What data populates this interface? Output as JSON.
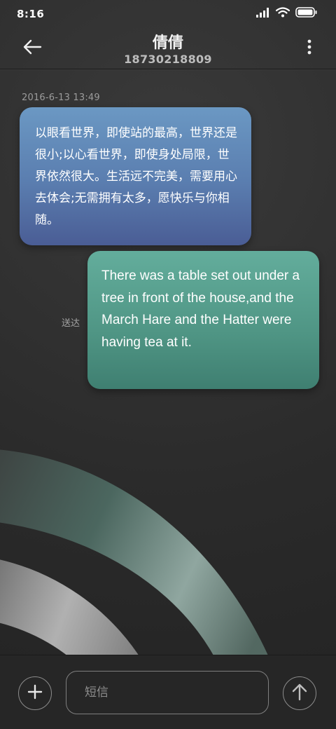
{
  "status_bar": {
    "time": "8:16",
    "icons": [
      "signal-icon",
      "wifi-icon",
      "battery-icon"
    ]
  },
  "header": {
    "contact_name": "倩倩",
    "contact_number": "18730218809",
    "back_icon": "back-arrow-icon",
    "menu_icon": "more-vertical-icon"
  },
  "conversation": {
    "timestamp": "2016-6-13 13:49",
    "messages": [
      {
        "direction": "incoming",
        "text": "以眼看世界，即使站的最高，世界还是很小;以心看世界，即使身处局限，世界依然很大。生活远不完美，需要用心去体会;无需拥有太多，愿快乐与你相随。"
      },
      {
        "direction": "outgoing",
        "text": "There was a table set out under a tree in front of the house,and the March Hare and the Hatter were having tea at it.",
        "status": "送达"
      }
    ]
  },
  "composer": {
    "placeholder": "短信",
    "value": "",
    "add_icon": "plus-icon",
    "send_icon": "send-arrow-icon"
  },
  "colors": {
    "incoming_bubble": "#5a7daf",
    "outgoing_bubble": "#4f9584",
    "background": "#2b2b2b"
  }
}
